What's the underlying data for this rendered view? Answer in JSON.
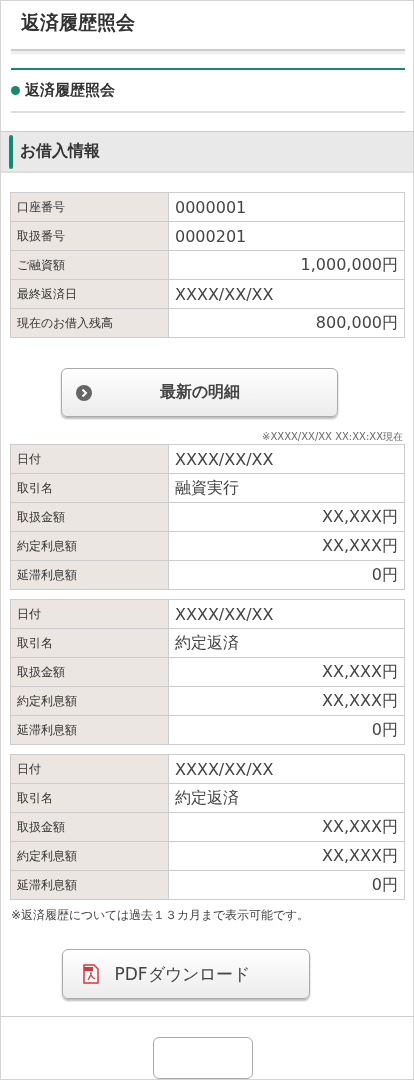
{
  "page_title": "返済履歴照会",
  "subtitle": "返済履歴照会",
  "section_title": "お借入情報",
  "loan_info": [
    {
      "label": "口座番号",
      "value": "0000001",
      "kind": "text"
    },
    {
      "label": "取扱番号",
      "value": "0000201",
      "kind": "text"
    },
    {
      "label": "ご融資額",
      "value": "1,000,000円",
      "kind": "amount"
    },
    {
      "label": "最終返済日",
      "value": "XXXX/XX/XX",
      "kind": "text"
    },
    {
      "label": "現在のお借入残高",
      "value": "800,000円",
      "kind": "amount"
    }
  ],
  "latest_button": "最新の明細",
  "as_of_note": "※XXXX/XX/XX XX:XX:XX現在",
  "history": [
    [
      {
        "label": "日付",
        "value": "XXXX/XX/XX",
        "kind": "text"
      },
      {
        "label": "取引名",
        "value": "融資実行",
        "kind": "text"
      },
      {
        "label": "取扱金額",
        "value": "XX,XXX円",
        "kind": "amount"
      },
      {
        "label": "約定利息額",
        "value": "XX,XXX円",
        "kind": "amount"
      },
      {
        "label": "延滞利息額",
        "value": "0円",
        "kind": "amount"
      }
    ],
    [
      {
        "label": "日付",
        "value": "XXXX/XX/XX",
        "kind": "text"
      },
      {
        "label": "取引名",
        "value": "約定返済",
        "kind": "text"
      },
      {
        "label": "取扱金額",
        "value": "XX,XXX円",
        "kind": "amount"
      },
      {
        "label": "約定利息額",
        "value": "XX,XXX円",
        "kind": "amount"
      },
      {
        "label": "延滞利息額",
        "value": "0円",
        "kind": "amount"
      }
    ],
    [
      {
        "label": "日付",
        "value": "XXXX/XX/XX",
        "kind": "text"
      },
      {
        "label": "取引名",
        "value": "約定返済",
        "kind": "text"
      },
      {
        "label": "取扱金額",
        "value": "XX,XXX円",
        "kind": "amount"
      },
      {
        "label": "約定利息額",
        "value": "XX,XXX円",
        "kind": "amount"
      },
      {
        "label": "延滞利息額",
        "value": "0円",
        "kind": "amount"
      }
    ]
  ],
  "history_note": "※返済履歴については過去１３カ月まで表示可能です。",
  "pdf_button": "PDFダウンロード"
}
